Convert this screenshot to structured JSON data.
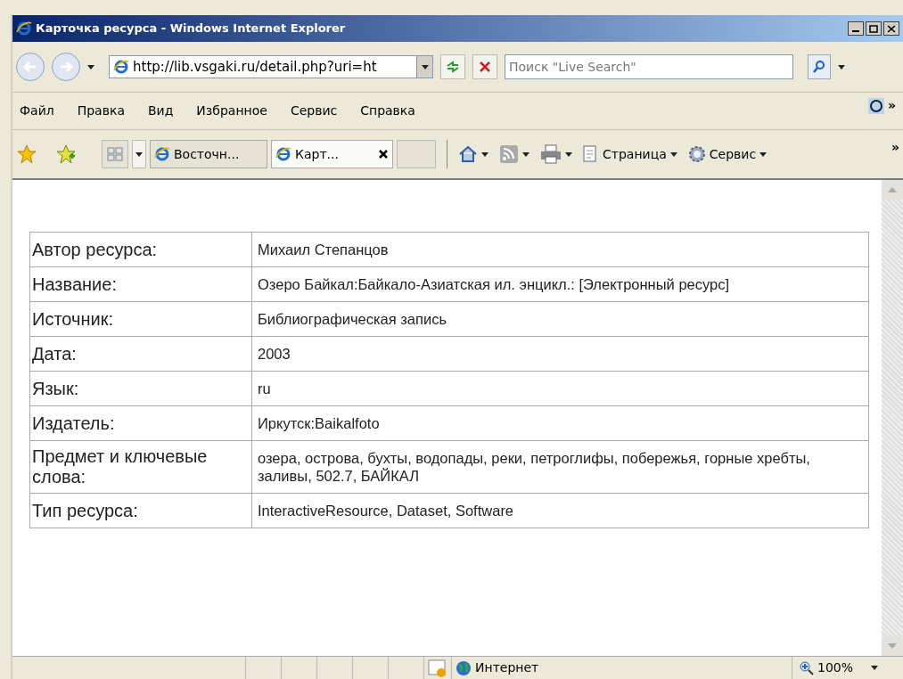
{
  "window": {
    "title": "Карточка ресурса - Windows Internet Explorer"
  },
  "address": {
    "value": "http://lib.vsgaki.ru/detail.php?uri=ht"
  },
  "search": {
    "placeholder": "Поиск \"Live Search\""
  },
  "menu": [
    "Файл",
    "Правка",
    "Вид",
    "Избранное",
    "Сервис",
    "Справка"
  ],
  "tabs": [
    {
      "label": "Восточн...",
      "selected": false
    },
    {
      "label": "Карт...",
      "selected": true
    }
  ],
  "toolbar": {
    "page": "Страница",
    "tools": "Сервис",
    "more": "»",
    "menu_more": "»"
  },
  "table": {
    "rows": [
      {
        "label": "Автор ресурса:",
        "value": "Михаил Степанцов"
      },
      {
        "label": "Название:",
        "value": "Озеро Байкал:Байкало-Азиатская ил. энцикл.: [Электронный ресурс]"
      },
      {
        "label": "Источник:",
        "value": "Библиографическая запись"
      },
      {
        "label": "Дата:",
        "value": "2003"
      },
      {
        "label": "Язык:",
        "value": "ru"
      },
      {
        "label": "Издатель:",
        "value": "Иркутск:Baikalfoto"
      },
      {
        "label": "Предмет и ключевые слова:",
        "value": "озера, острова, бухты, водопады, реки, петроглифы, побережья, горные хребты, заливы, 502.7, БАЙКАЛ"
      },
      {
        "label": "Тип ресурса:",
        "value": "InteractiveResource, Dataset, Software"
      }
    ]
  },
  "status_bar": {
    "zone": "Интернет",
    "zoom": "100%"
  }
}
